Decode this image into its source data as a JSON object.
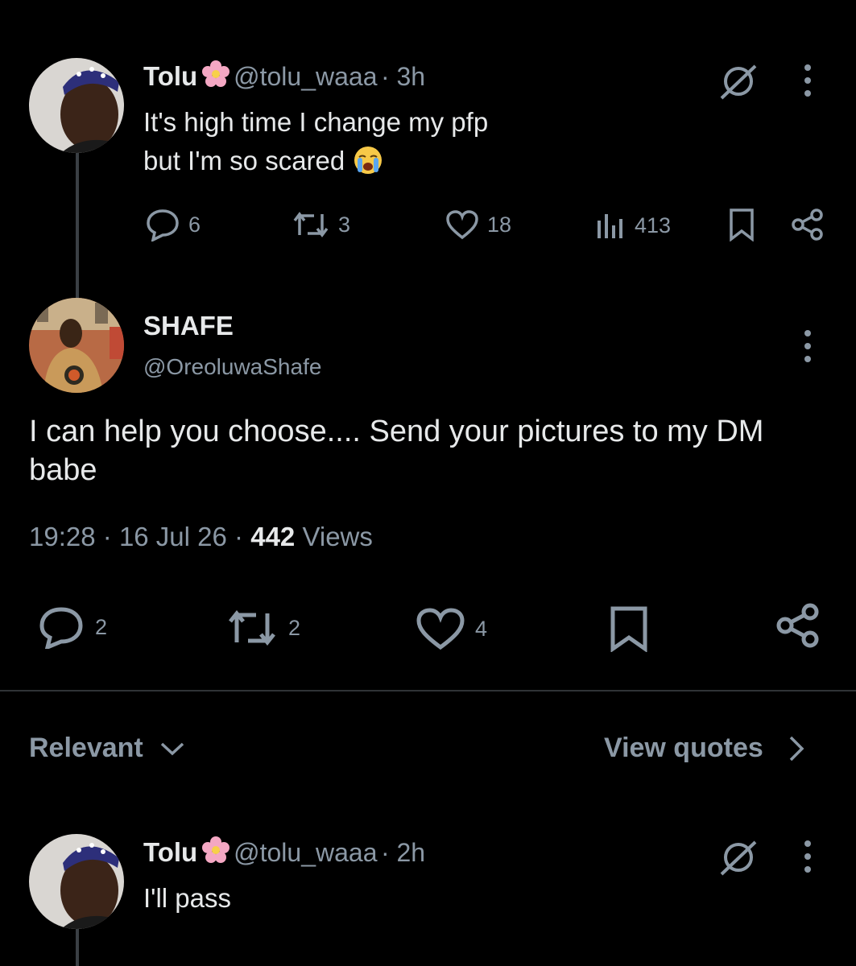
{
  "tweet1": {
    "name": "Tolu",
    "handle": "@tolu_waaa",
    "time": "3h",
    "line1": "It's high time I change my pfp",
    "line2": "but I'm so scared",
    "replies": "6",
    "retweets": "3",
    "likes": "18",
    "views": "413"
  },
  "main": {
    "name": "SHAFE",
    "handle": "@OreoluwaShafe",
    "text_line1": "I can help you choose.... Send your pictures to my DM",
    "text_line2": "babe",
    "time": "19:28",
    "date": "16 Jul 26",
    "views_count": "442",
    "views_label": "Views",
    "replies": "2",
    "retweets": "2",
    "likes": "4"
  },
  "sort": {
    "label": "Relevant",
    "view_quotes": "View quotes"
  },
  "reply1": {
    "name": "Tolu",
    "handle": "@tolu_waaa",
    "time": "2h",
    "text": "I'll pass"
  },
  "colors": {
    "background": "#000000",
    "text": "#e7e9ea",
    "muted": "#8b98a5",
    "flower": "#f4a7c3"
  },
  "icons": [
    "grok-icon",
    "more-icon",
    "reply-icon",
    "retweet-icon",
    "like-icon",
    "views-icon",
    "bookmark-icon",
    "share-icon",
    "chevron-down-icon",
    "chevron-right-icon",
    "flower-emoji",
    "crying-emoji"
  ]
}
